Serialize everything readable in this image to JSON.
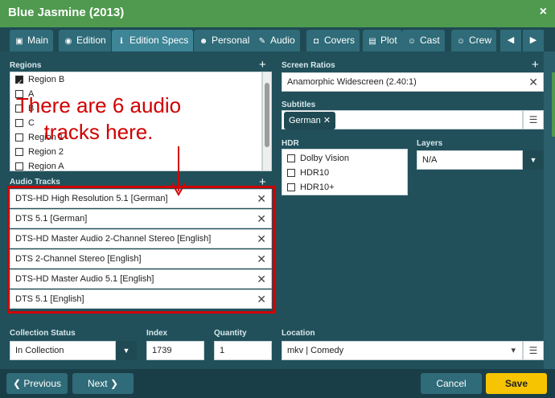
{
  "window": {
    "title": "Blue Jasmine (2013)",
    "close": "×"
  },
  "tabs": [
    {
      "label": "Main",
      "icon": "main-icon",
      "glyph": "▣"
    },
    {
      "label": "Edition",
      "icon": "edition-icon",
      "glyph": "◉"
    },
    {
      "label": "Edition Specs",
      "icon": "info-icon",
      "glyph": "ℹ"
    },
    {
      "label": "Personal",
      "icon": "person-icon",
      "glyph": "☻"
    },
    {
      "label": "Audio",
      "icon": "audio-icon",
      "glyph": "✎"
    },
    {
      "label": "Covers",
      "icon": "camera-icon",
      "glyph": "◘"
    },
    {
      "label": "Plot",
      "icon": "document-icon",
      "glyph": "▤"
    },
    {
      "label": "Cast",
      "icon": "cast-icon",
      "glyph": "☺"
    },
    {
      "label": "Crew",
      "icon": "crew-icon",
      "glyph": "☺"
    }
  ],
  "nav_arrows": {
    "prev": "◀",
    "next": "▶"
  },
  "regions": {
    "label": "Regions",
    "add": "+",
    "items": [
      {
        "label": "Region B",
        "checked": true
      },
      {
        "label": "A",
        "checked": false
      },
      {
        "label": "B",
        "checked": false
      },
      {
        "label": "C",
        "checked": false
      },
      {
        "label": "Region 1",
        "checked": false
      },
      {
        "label": "Region 2",
        "checked": false
      },
      {
        "label": "Region A",
        "checked": false
      }
    ]
  },
  "audio_tracks": {
    "label": "Audio Tracks",
    "add": "+",
    "remove": "✕",
    "items": [
      "DTS-HD High Resolution 5.1 [German]",
      "DTS 5.1 [German]",
      "DTS-HD Master Audio 2-Channel Stereo [English]",
      "DTS 2-Channel Stereo [English]",
      "DTS-HD Master Audio 5.1 [English]",
      "DTS 5.1 [English]"
    ]
  },
  "annotation": {
    "line1": "There are 6 audio",
    "line2": "tracks here."
  },
  "screen_ratios": {
    "label": "Screen Ratios",
    "add": "+",
    "value": "Anamorphic Widescreen (2.40:1)",
    "remove": "✕"
  },
  "subtitles": {
    "label": "Subtitles",
    "chip": "German",
    "chip_remove": "✕",
    "list_glyph": "☰"
  },
  "hdr": {
    "label": "HDR",
    "items": [
      {
        "label": "Dolby Vision",
        "checked": false
      },
      {
        "label": "HDR10",
        "checked": false
      },
      {
        "label": "HDR10+",
        "checked": false
      }
    ]
  },
  "layers": {
    "label": "Layers",
    "value": "N/A",
    "dd": "▼"
  },
  "collection_status": {
    "label": "Collection Status",
    "value": "In Collection",
    "dd": "▼"
  },
  "index": {
    "label": "Index",
    "value": "1739"
  },
  "quantity": {
    "label": "Quantity",
    "value": "1"
  },
  "location": {
    "label": "Location",
    "value": "mkv | Comedy",
    "dd": "▾",
    "list_glyph": "☰"
  },
  "buttons": {
    "previous": "❮ Previous",
    "next": "Next ❯",
    "cancel": "Cancel",
    "save": "Save"
  },
  "colors": {
    "title_bar": "#4f9a4f",
    "background": "#21505b",
    "annotation": "#d10000",
    "save": "#f6c400"
  }
}
